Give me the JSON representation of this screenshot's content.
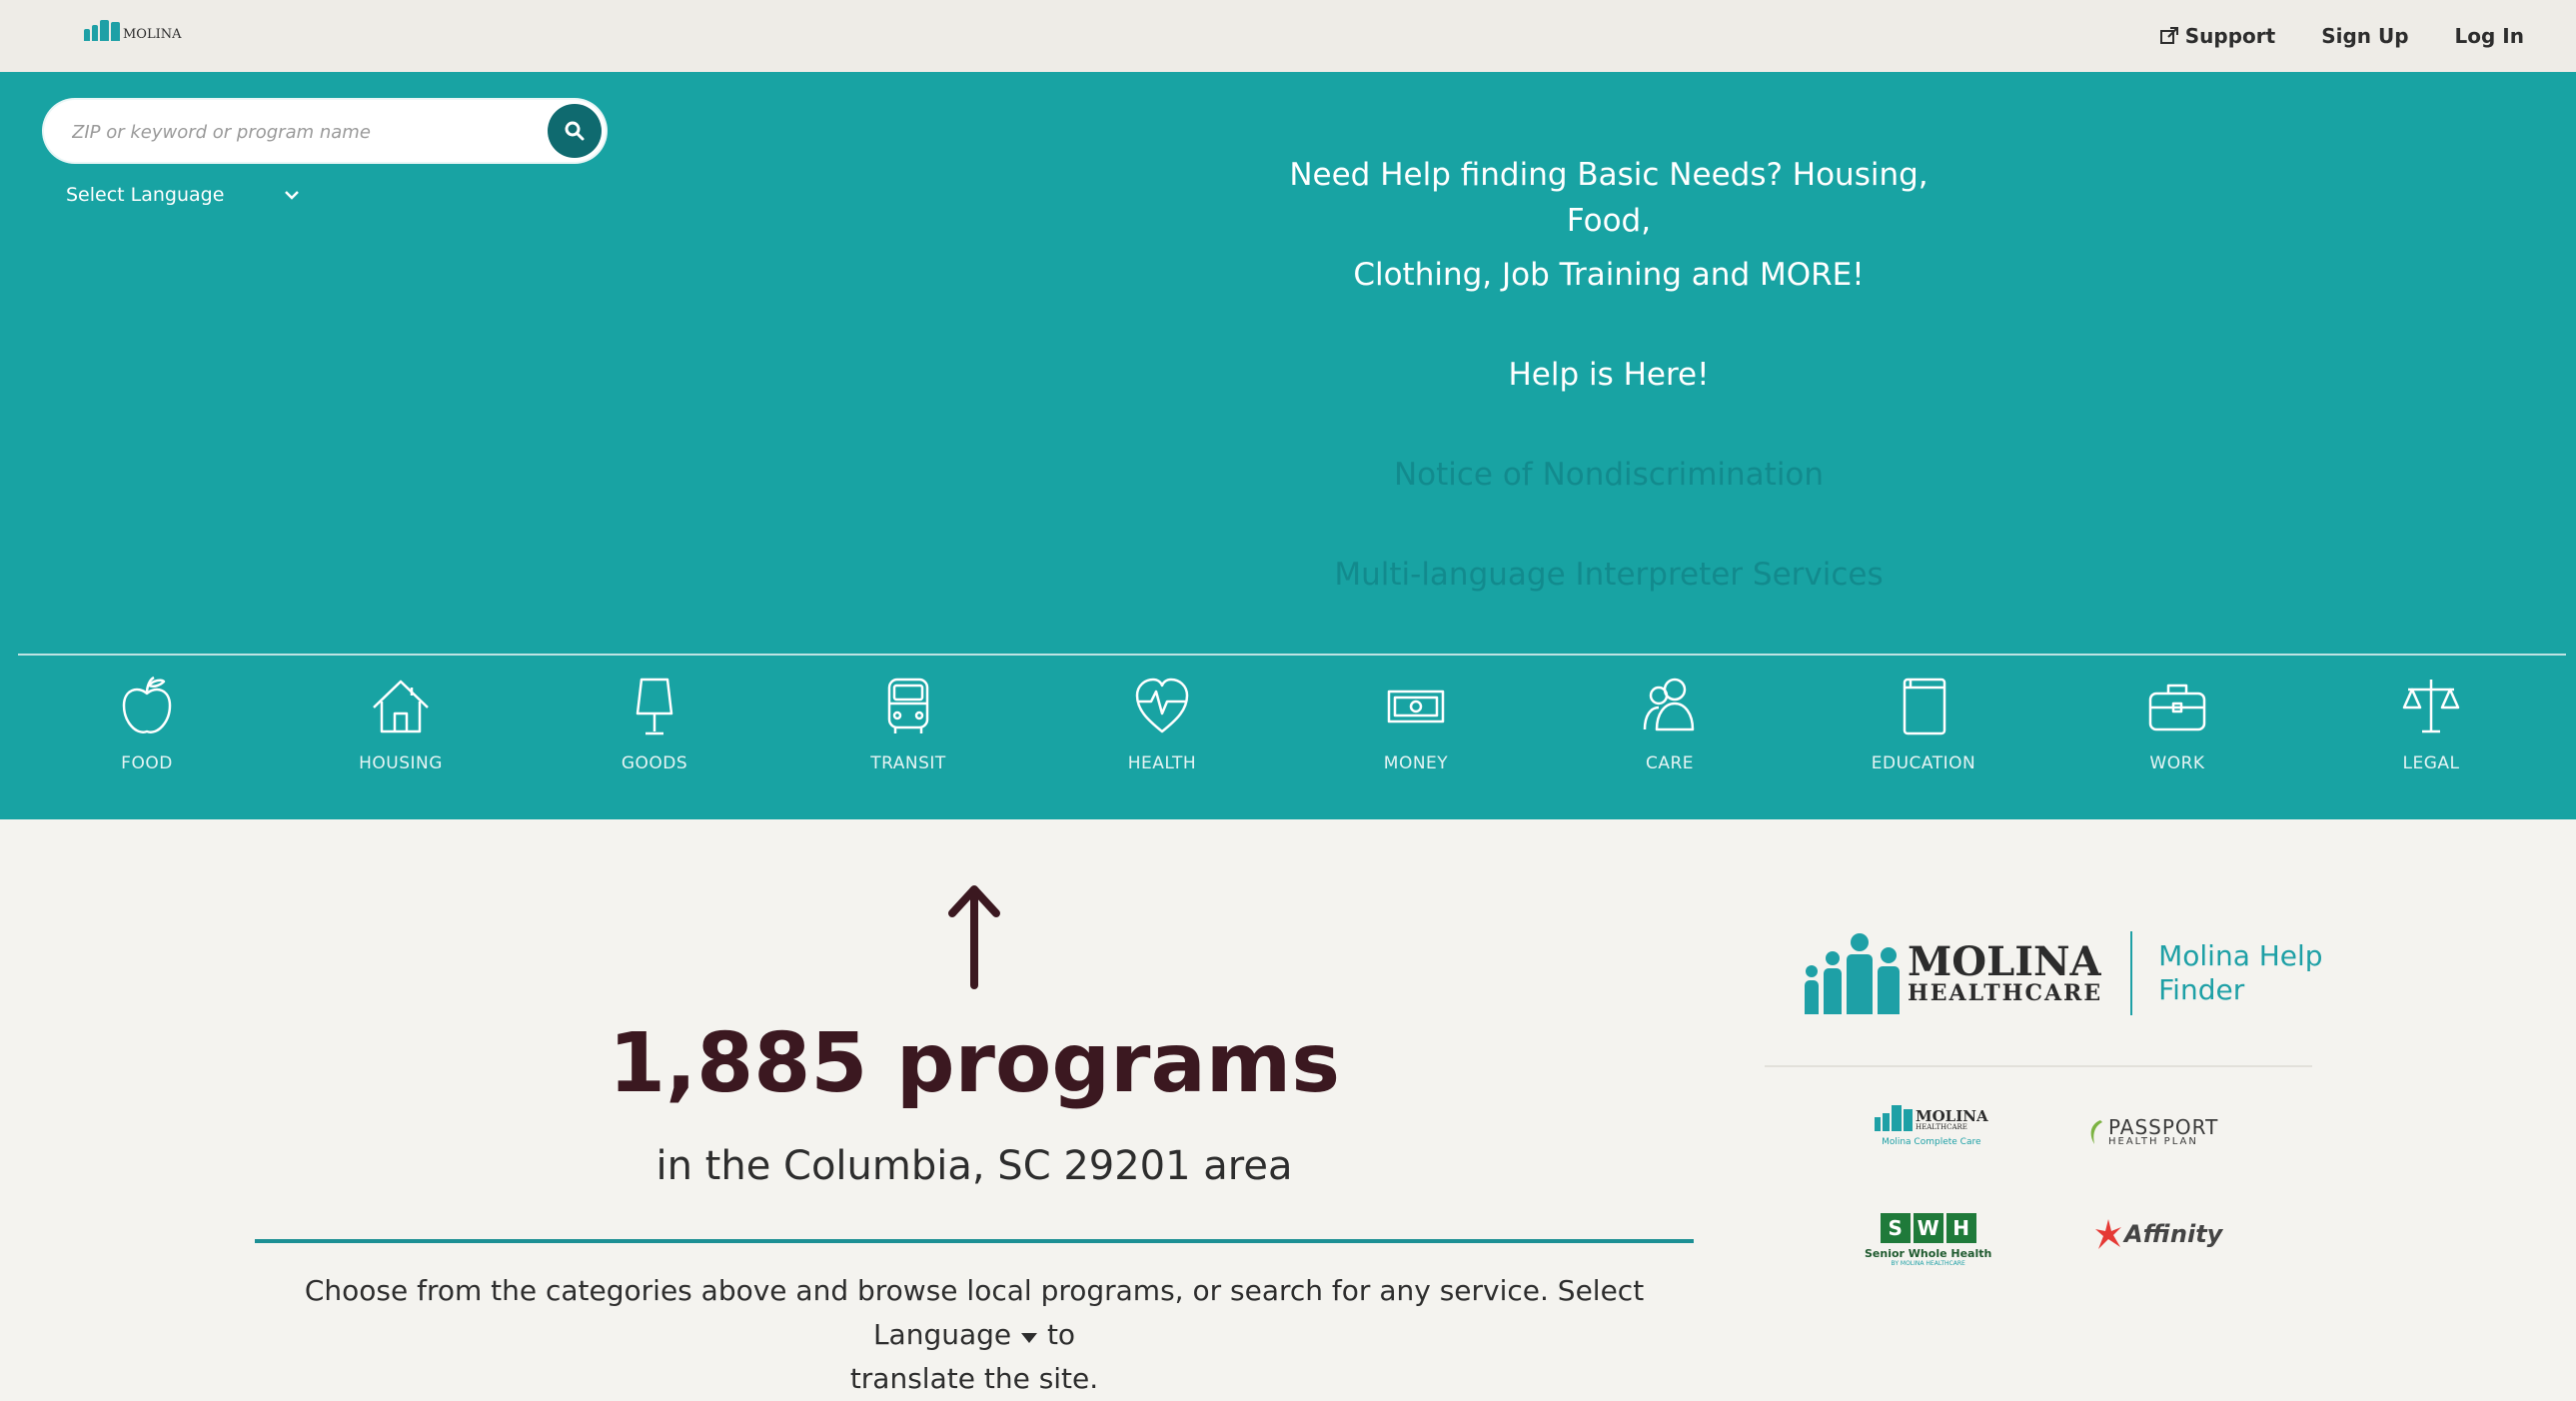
{
  "header": {
    "logo_text": "MOLINA",
    "nav": [
      {
        "label": "Support",
        "icon": "external-link-icon"
      },
      {
        "label": "Sign Up"
      },
      {
        "label": "Log In"
      }
    ]
  },
  "search": {
    "placeholder": "ZIP or keyword or program name",
    "icon": "search-icon"
  },
  "language": {
    "label": "Select Language"
  },
  "hero": {
    "lines": [
      "Need Help finding Basic Needs? Housing, Food,",
      "Clothing, Job Training and MORE!",
      "Help is Here!",
      "Notice of Nondiscrimination",
      "Multi-language Interpreter Services"
    ]
  },
  "categories": [
    {
      "label": "FOOD",
      "icon": "apple-icon"
    },
    {
      "label": "HOUSING",
      "icon": "house-icon"
    },
    {
      "label": "GOODS",
      "icon": "lamp-icon"
    },
    {
      "label": "TRANSIT",
      "icon": "bus-icon"
    },
    {
      "label": "HEALTH",
      "icon": "heart-pulse-icon"
    },
    {
      "label": "MONEY",
      "icon": "banknote-icon"
    },
    {
      "label": "CARE",
      "icon": "people-icon"
    },
    {
      "label": "EDUCATION",
      "icon": "book-icon"
    },
    {
      "label": "WORK",
      "icon": "briefcase-icon"
    },
    {
      "label": "LEGAL",
      "icon": "scales-icon"
    }
  ],
  "results": {
    "count": "1,885 programs",
    "area": "in the Columbia, SC 29201 area",
    "instruction_part1": "Choose from the categories above and browse local programs, or search for any service. Select Language",
    "instruction_part2": "to",
    "instruction_part3": "translate the site."
  },
  "brand": {
    "wordmark": "MOLINA",
    "wordmark_sub": "HEALTHCARE",
    "product_line1": "Molina Help",
    "product_line2": "Finder"
  },
  "partners": {
    "molina_complete": {
      "name": "MOLINA",
      "sub": "HEALTHCARE",
      "caption": "Molina Complete Care"
    },
    "passport": {
      "name": "PASSPORT",
      "sub": "HEALTH PLAN"
    },
    "swh": {
      "letters": [
        "S",
        "W",
        "H"
      ],
      "name": "Senior Whole Health",
      "sub": "BY MOLINA HEALTHCARE"
    },
    "affinity": {
      "name": "Affinity"
    }
  },
  "colors": {
    "teal": "#18a3a3",
    "dark_teal": "#0f6a6f",
    "count_text": "#3b1820"
  }
}
